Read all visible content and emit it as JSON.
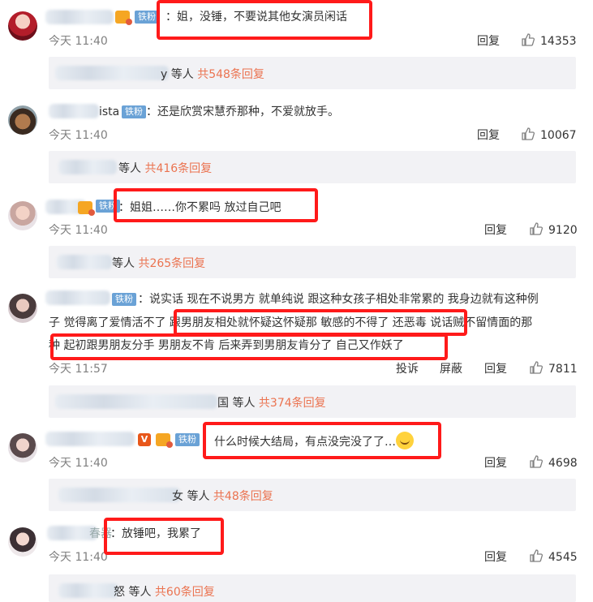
{
  "comments": [
    {
      "text": "：姐，没锤，不要说其他女演员闲话",
      "badge": "铁粉",
      "time": "今天 11:40",
      "reply_label": "回复",
      "likes": "14353",
      "replies_prefix": "y 等人",
      "replies_count": "共548条回复"
    },
    {
      "name_suffix": "ista",
      "text": "：还是欣赏宋慧乔那种，不爱就放手。",
      "badge": "铁粉",
      "time": "今天 11:40",
      "reply_label": "回复",
      "likes": "10067",
      "replies_prefix": "等人",
      "replies_count": "共416条回复"
    },
    {
      "text": "：姐姐……你不累吗 放过自己吧",
      "badge": "铁粉",
      "time": "今天 11:40",
      "reply_label": "回复",
      "likes": "9120",
      "replies_prefix": "等人",
      "replies_count": "共265条回复"
    },
    {
      "text_line1": "：说实话 现在不说男方  就单纯说 跟这种女孩子相处非常累的 我身边就有这种例",
      "text_line2": "子  觉得离了爱情活不了 跟男朋友相处就怀疑这怀疑那 敏感的不得了  还恶毒 说话贼不留情面的那",
      "text_line3": "种 起初跟男朋友分手 男朋友不肯 后来弄到男朋友肯分了 自己又作妖了",
      "badge": "铁粉",
      "time": "今天 11:57",
      "report_label": "投诉",
      "block_label": "屏蔽",
      "reply_label": "回复",
      "likes": "7811",
      "replies_prefix": "国 等人",
      "replies_count": "共374条回复"
    },
    {
      "text": "什么时候大结局，有点没完没了了…",
      "badge": "铁粉",
      "v_badge": "V",
      "time": "今天 11:40",
      "reply_label": "回复",
      "likes": "4698",
      "replies_prefix": "女 等人",
      "replies_count": "共48条回复"
    },
    {
      "name_suffix": "春器",
      "text": "：放锤吧，我累了",
      "time": "今天 11:40",
      "reply_label": "回复",
      "likes": "4545",
      "replies_prefix": "怒 等人",
      "replies_count": "共60条回复"
    }
  ]
}
